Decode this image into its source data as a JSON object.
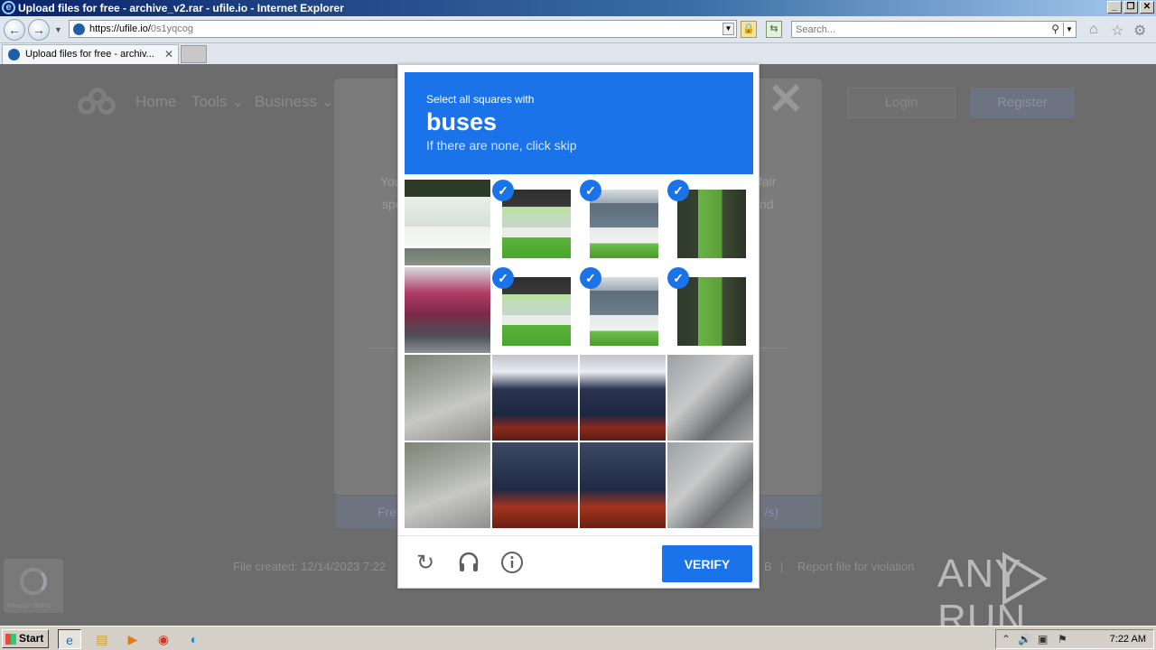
{
  "browser": {
    "window_title": "Upload files for free - archive_v2.rar - ufile.io - Internet Explorer",
    "url_host": "https://ufile.io/",
    "url_path": "0s1yqcog",
    "search_placeholder": "Search...",
    "tab_title": "Upload files for free - archiv..."
  },
  "site": {
    "nav": [
      {
        "label": "Home"
      },
      {
        "label": "Tools ⌄"
      },
      {
        "label": "Business ⌄"
      }
    ],
    "login_label": "Login",
    "register_label": "Register",
    "modal_left_1": "You",
    "modal_left_2": "spe",
    "modal_right_1": "fair",
    "modal_right_2": "nd",
    "download_left": "Fre",
    "download_right": "/s)",
    "file_created": "File created: 12/14/2023 7:22",
    "file_size_fragment": "B",
    "separator": "|",
    "report_link": "Report file for violation"
  },
  "captcha": {
    "prompt_line1": "Select all squares with",
    "target": "buses",
    "prompt_line3": "If there are none, click skip",
    "verify_label": "VERIFY",
    "rows": [
      [
        {
          "selected": false,
          "style": "bus-white"
        },
        {
          "selected": true,
          "style": "bus-img"
        },
        {
          "selected": true,
          "style": "bus-img2"
        },
        {
          "selected": true,
          "style": "bus-img3"
        }
      ],
      [
        {
          "selected": false,
          "style": "pink-car"
        },
        {
          "selected": true,
          "style": "bus-img"
        },
        {
          "selected": true,
          "style": "bus-img2"
        },
        {
          "selected": true,
          "style": "bus-img3"
        }
      ],
      [
        {
          "selected": false,
          "style": "road-img"
        },
        {
          "selected": false,
          "style": "car-img"
        },
        {
          "selected": false,
          "style": "car-img"
        },
        {
          "selected": false,
          "style": "street-img"
        }
      ],
      [
        {
          "selected": false,
          "style": "road-img"
        },
        {
          "selected": false,
          "style": "car-img2"
        },
        {
          "selected": false,
          "style": "car-img2"
        },
        {
          "selected": false,
          "style": "street-img"
        }
      ]
    ]
  },
  "watermark": {
    "text": "ANY RUN"
  },
  "taskbar": {
    "start_label": "Start",
    "clock": "7:22 AM"
  }
}
